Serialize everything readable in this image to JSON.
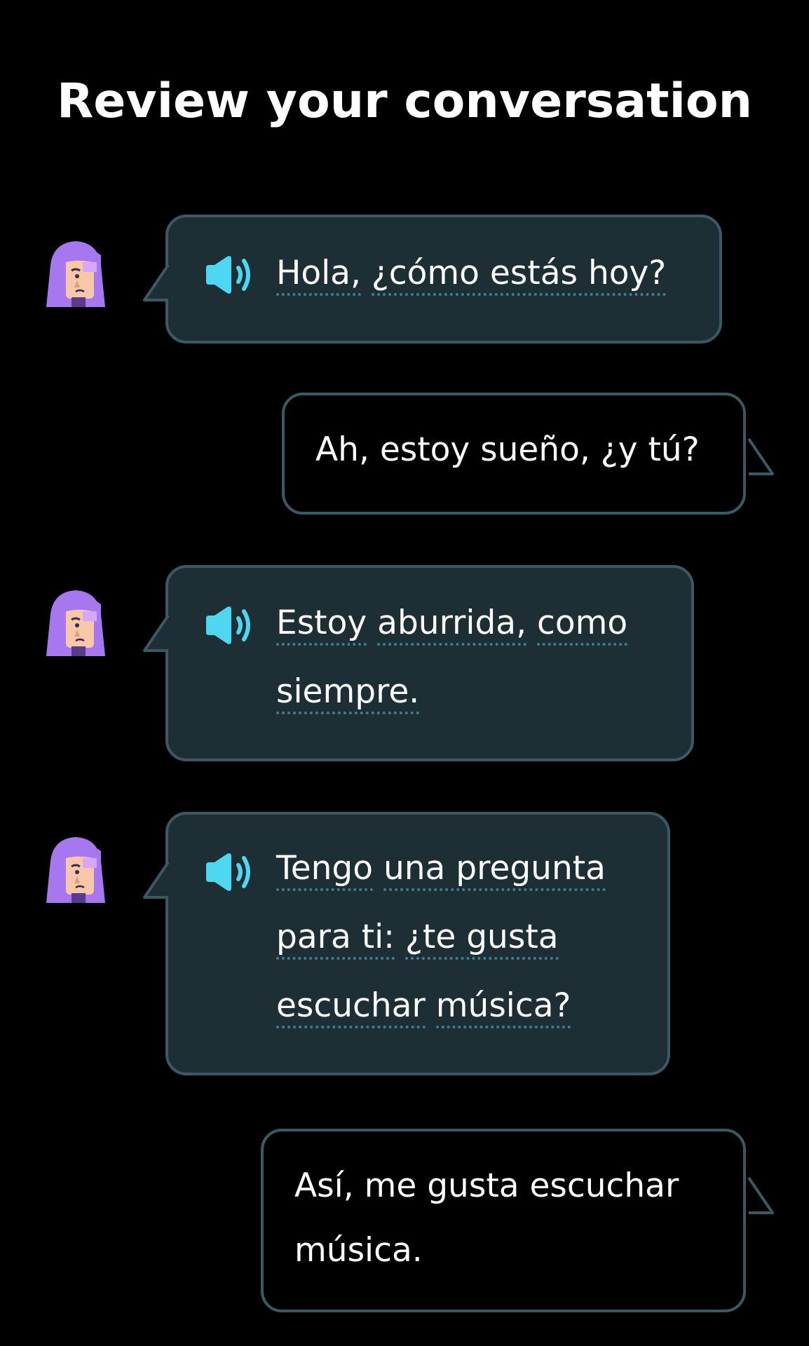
{
  "header": {
    "title": "Review your conversation"
  },
  "colors": {
    "background": "#000000",
    "partner_bubble": "#1d2e35",
    "bubble_border": "#3b5963",
    "speaker_icon": "#4fd7f2",
    "avatar_hair": "#a777f0",
    "underline": "#3d7f93"
  },
  "icons": {
    "speaker": "speaker-icon",
    "avatar": "avatar-icon"
  },
  "messages": [
    {
      "sender": "partner",
      "lines": [
        [
          "Hola,",
          "¿cómo estás hoy?"
        ]
      ]
    },
    {
      "sender": "user",
      "lines": [
        [
          "Ah, estoy sueño, ¿y tú?"
        ]
      ]
    },
    {
      "sender": "partner",
      "lines": [
        [
          "Estoy",
          "aburrida,",
          "como"
        ],
        [
          "siempre."
        ]
      ]
    },
    {
      "sender": "partner",
      "lines": [
        [
          "Tengo",
          "una pregunta"
        ],
        [
          "para ti:",
          "¿te gusta"
        ],
        [
          "escuchar",
          "música?"
        ]
      ]
    },
    {
      "sender": "user",
      "lines": [
        [
          "Así, me gusta escuchar"
        ],
        [
          "música."
        ]
      ]
    }
  ]
}
